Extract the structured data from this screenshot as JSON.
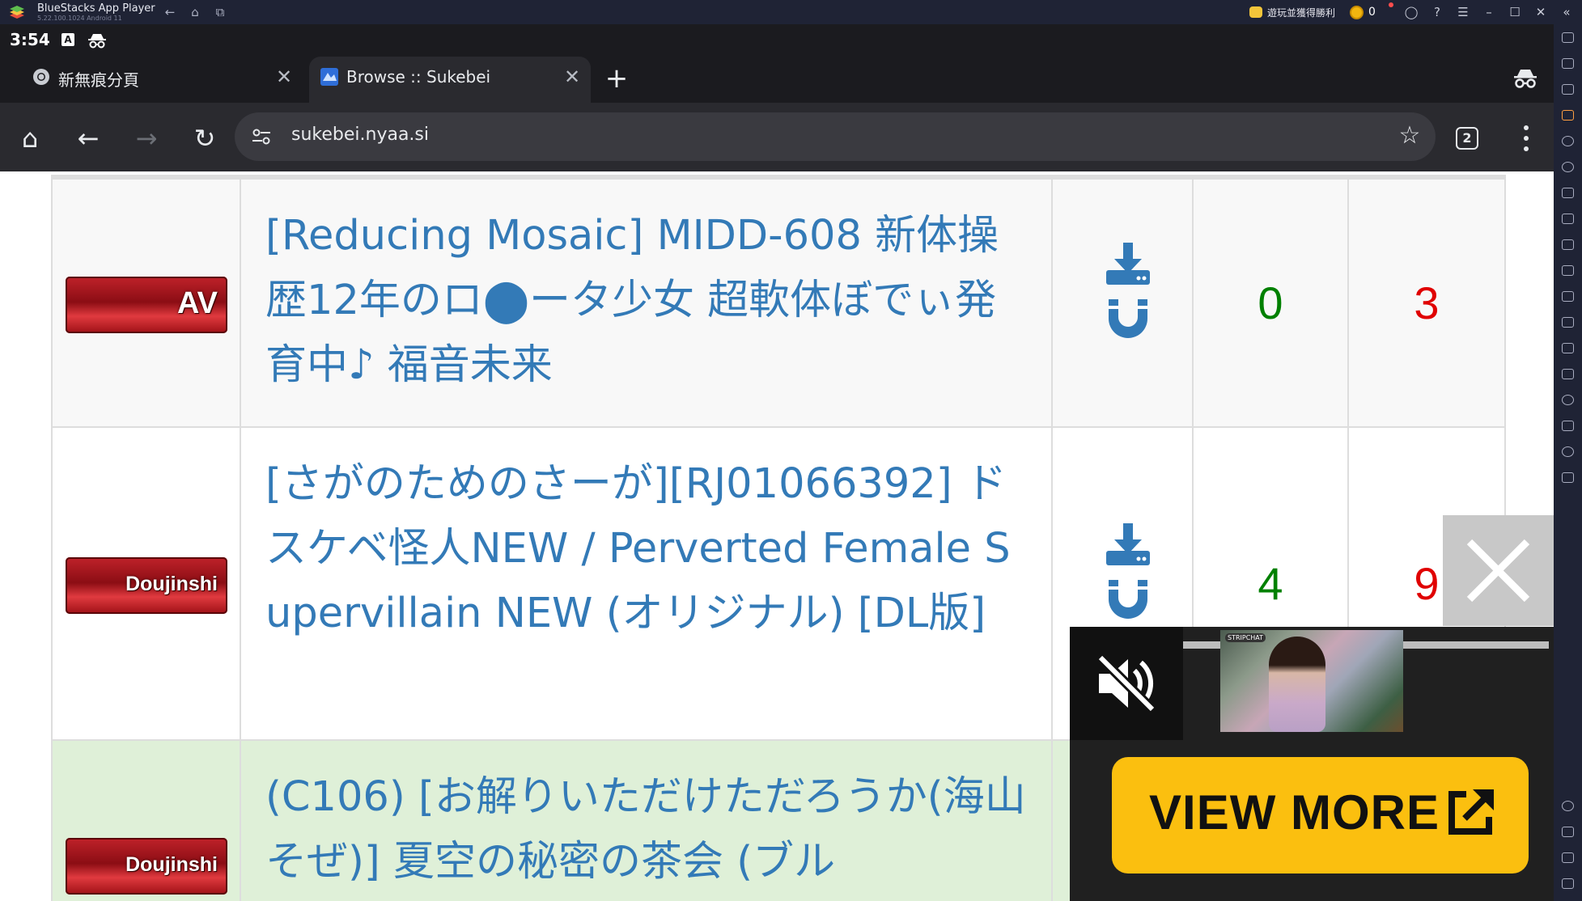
{
  "emulator": {
    "app_name": "BlueStacks App Player",
    "version": "5.22.100.1024  Android 11",
    "promo_label": "遊玩並獲得勝利",
    "coin_count": "0"
  },
  "status_bar": {
    "time": "3:54",
    "a_badge": "A"
  },
  "tabs": [
    {
      "title": "新無痕分頁",
      "active": false,
      "close": "✕"
    },
    {
      "title": "Browse :: Sukebei",
      "active": true,
      "close": "✕"
    }
  ],
  "new_tab_glyph": "+",
  "toolbar": {
    "home_glyph": "⌂",
    "back_glyph": "←",
    "forward_glyph": "→",
    "reload_glyph": "↻",
    "url": "sukebei.nyaa.si",
    "star_glyph": "☆",
    "tab_count": "2"
  },
  "torrents": [
    {
      "category": "AV",
      "name": "[Reducing Mosaic] MIDD-608 新体操歴12年のロ⬤ータ少女 超軟体ぼでぃ発育中♪ 福音未来",
      "seeders": "0",
      "leechers": "3"
    },
    {
      "category": "Doujinshi",
      "name": "[さがのためのさーが][RJ01066392] ドスケベ怪人NEW / Perverted Female Supervillain NEW (オリジナル) [DL版]",
      "seeders": "4",
      "leechers": "9"
    },
    {
      "category": "Doujinshi",
      "name": "(C106) [お解りいただけただろうか(海山そぜ)] 夏空の秘密の茶会 (ブル",
      "seeders": "",
      "leechers": ""
    }
  ],
  "ad": {
    "cta_label": "VIEW MORE",
    "thumb_logo": "STRIPCHAT",
    "progress": 0.22
  },
  "colors": {
    "link": "#337ab7",
    "seed": "#008000",
    "leech": "#e00000",
    "cta": "#fbbf0f",
    "success_row": "#dff0d8"
  }
}
